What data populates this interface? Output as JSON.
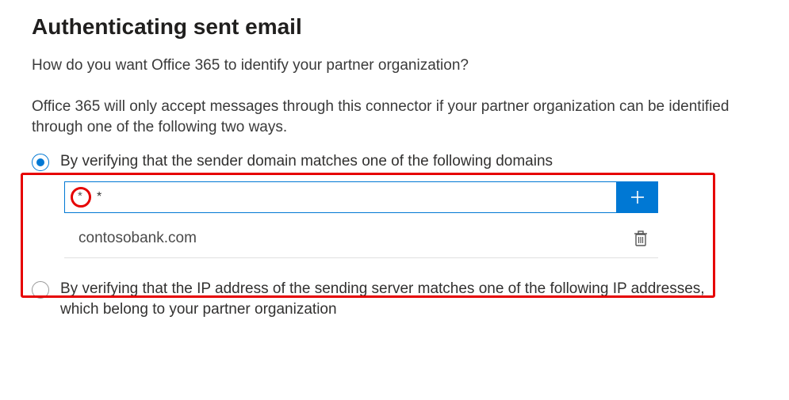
{
  "title": "Authenticating sent email",
  "subtitle": "How do you want Office 365 to identify your partner organization?",
  "description": "Office 365 will only accept messages through this connector if your partner organization can be identified through one of the following two ways.",
  "options": {
    "domain": {
      "label": "By verifying that the sender domain matches one of the following domains",
      "selected": true,
      "input_value": "*",
      "entries": [
        "contosobank.com"
      ]
    },
    "ip": {
      "label": "By verifying that the IP address of the sending server matches one of the following IP addresses, which belong to your partner organization",
      "selected": false
    }
  },
  "colors": {
    "accent": "#0078d4",
    "highlight": "#e60000"
  }
}
